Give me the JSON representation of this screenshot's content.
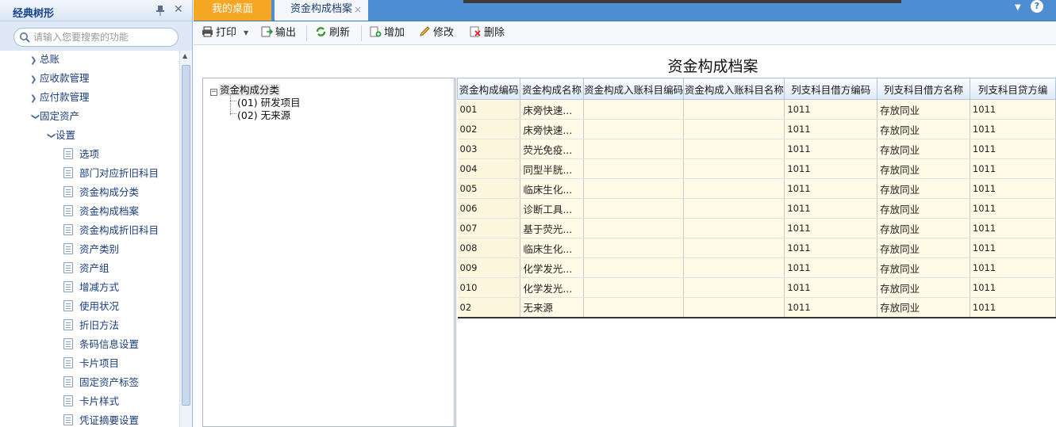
{
  "sidebar": {
    "title": "经典树形",
    "search_placeholder": "请输入您要搜索的功能",
    "items": [
      {
        "label": "总账",
        "expanded": false
      },
      {
        "label": "应收款管理",
        "expanded": false
      },
      {
        "label": "应付款管理",
        "expanded": false
      },
      {
        "label": "固定资产",
        "expanded": true
      },
      {
        "label": "设置",
        "expanded": true
      },
      {
        "label": "选项"
      },
      {
        "label": "部门对应折旧科目"
      },
      {
        "label": "资金构成分类"
      },
      {
        "label": "资金构成档案"
      },
      {
        "label": "资金构成折旧科目"
      },
      {
        "label": "资产类别"
      },
      {
        "label": "资产组"
      },
      {
        "label": "增减方式"
      },
      {
        "label": "使用状况"
      },
      {
        "label": "折旧方法"
      },
      {
        "label": "条码信息设置"
      },
      {
        "label": "卡片项目"
      },
      {
        "label": "固定资产标签"
      },
      {
        "label": "卡片样式"
      },
      {
        "label": "凭证摘要设置"
      }
    ]
  },
  "tabs": {
    "home": "我的桌面",
    "active": "资金构成档案",
    "close_glyph": "×",
    "dropdown_glyph": "▼",
    "help_glyph": "?"
  },
  "toolbar": {
    "print": "打印",
    "export": "输出",
    "refresh": "刷新",
    "add": "增加",
    "edit": "修改",
    "delete": "删除"
  },
  "main": {
    "title": "资金构成档案",
    "tree": {
      "root": "资金构成分类",
      "collapse_glyph": "−",
      "children": [
        "(01) 研发项目",
        "(02) 无来源"
      ]
    },
    "table": {
      "headers": [
        "资金构成编码",
        "资金构成名称",
        "资金构成入账科目编码",
        "资金构成入账科目名称",
        "列支科目借方编码",
        "列支科目借方名称",
        "列支科目贷方编"
      ],
      "rows": [
        [
          "001",
          "床旁快速...",
          "",
          "",
          "1011",
          "存放同业",
          "1011"
        ],
        [
          "002",
          "床旁快速...",
          "",
          "",
          "1011",
          "存放同业",
          "1011"
        ],
        [
          "003",
          "荧光免疫...",
          "",
          "",
          "1011",
          "存放同业",
          "1011"
        ],
        [
          "004",
          "同型半胱...",
          "",
          "",
          "1011",
          "存放同业",
          "1011"
        ],
        [
          "005",
          "临床生化...",
          "",
          "",
          "1011",
          "存放同业",
          "1011"
        ],
        [
          "006",
          "诊断工具...",
          "",
          "",
          "1011",
          "存放同业",
          "1011"
        ],
        [
          "007",
          "基于荧光...",
          "",
          "",
          "1011",
          "存放同业",
          "1011"
        ],
        [
          "008",
          "临床生化...",
          "",
          "",
          "1011",
          "存放同业",
          "1011"
        ],
        [
          "009",
          "化学发光...",
          "",
          "",
          "1011",
          "存放同业",
          "1011"
        ],
        [
          "010",
          "化学发光...",
          "",
          "",
          "1011",
          "存放同业",
          "1011"
        ],
        [
          "02",
          "无来源",
          "",
          "",
          "1011",
          "存放同业",
          "1011"
        ]
      ]
    }
  },
  "colors": {
    "accent": "#4d8ed3",
    "home_tab": "#f5a623",
    "row_bg": "#fffbe6"
  }
}
